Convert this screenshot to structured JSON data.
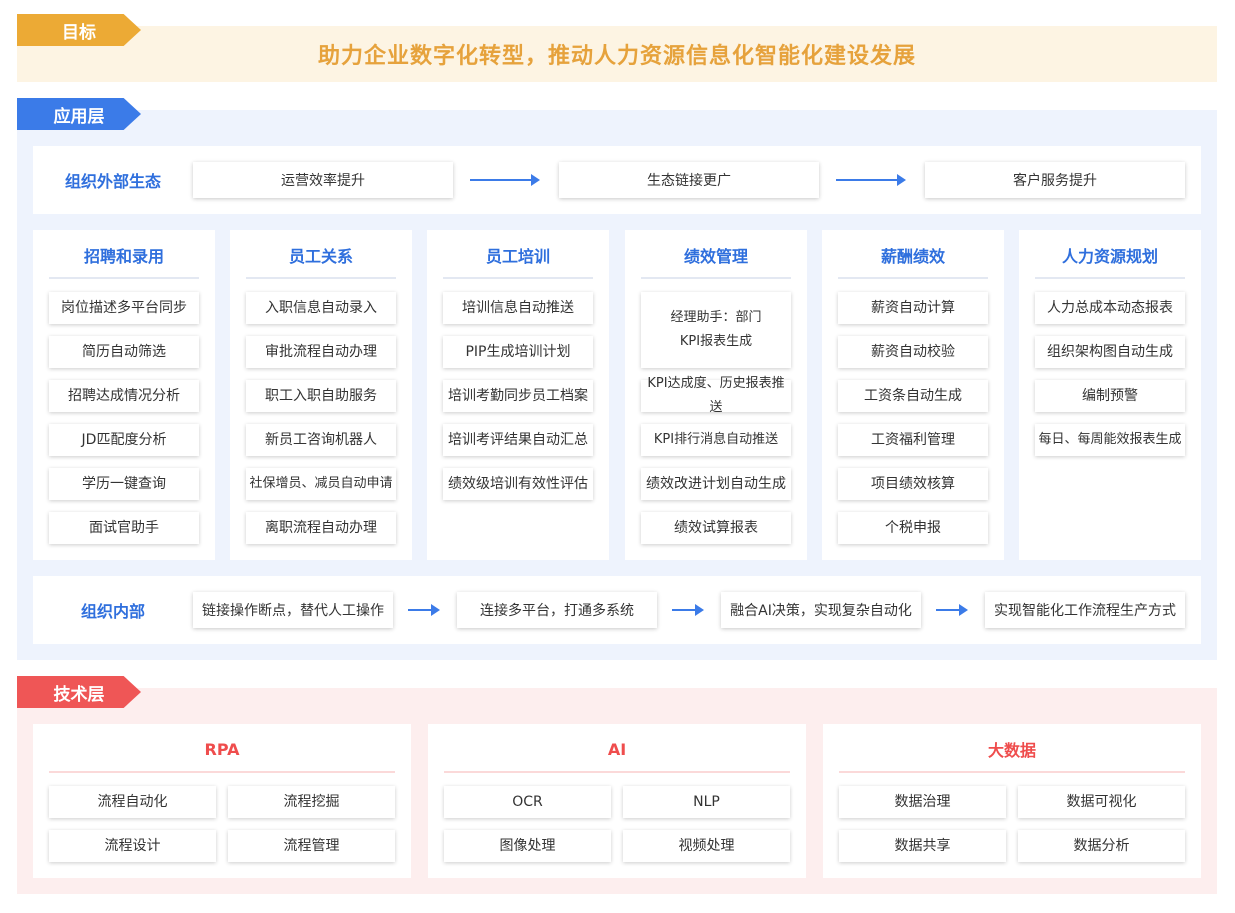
{
  "goal": {
    "tab": "目标",
    "text": "助力企业数字化转型，推动人力资源信息化智能化建设发展"
  },
  "app": {
    "tab": "应用层",
    "external": {
      "label": "组织外部生态",
      "steps": [
        "运营效率提升",
        "生态链接更广",
        "客户服务提升"
      ]
    },
    "columns": [
      {
        "title": "招聘和录用",
        "items": [
          "岗位描述多平台同步",
          "简历自动筛选",
          "招聘达成情况分析",
          "JD匹配度分析",
          "学历一键查询",
          "面试官助手"
        ]
      },
      {
        "title": "员工关系",
        "items": [
          "入职信息自动录入",
          "审批流程自动办理",
          "职工入职自助服务",
          "新员工咨询机器人",
          "社保增员、减员自动申请",
          "离职流程自动办理"
        ]
      },
      {
        "title": "员工培训",
        "items": [
          "培训信息自动推送",
          "PIP生成培训计划",
          "培训考勤同步员工档案",
          "培训考评结果自动汇总",
          "绩效级培训有效性评估"
        ]
      },
      {
        "title": "绩效管理",
        "items": [
          "经理助手：部门KPI报表生成",
          "KPI达成度、历史报表推送",
          "KPI排行消息自动推送",
          "绩效改进计划自动生成",
          "绩效试算报表"
        ]
      },
      {
        "title": "薪酬绩效",
        "items": [
          "薪资自动计算",
          "薪资自动校验",
          "工资条自动生成",
          "工资福利管理",
          "项目绩效核算",
          "个税申报"
        ]
      },
      {
        "title": "人力资源规划",
        "items": [
          "人力总成本动态报表",
          "组织架构图自动生成",
          "编制预警",
          "每日、每周能效报表生成"
        ]
      }
    ],
    "internal": {
      "label": "组织内部",
      "steps": [
        "链接操作断点，替代人工操作",
        "连接多平台，打通多系统",
        "融合AI决策，实现复杂自动化",
        "实现智能化工作流程生产方式"
      ]
    }
  },
  "tech": {
    "tab": "技术层",
    "groups": [
      {
        "title": "RPA",
        "items": [
          "流程自动化",
          "流程挖掘",
          "流程设计",
          "流程管理"
        ]
      },
      {
        "title": "AI",
        "items": [
          "OCR",
          "NLP",
          "图像处理",
          "视频处理"
        ]
      },
      {
        "title": "大数据",
        "items": [
          "数据治理",
          "数据可视化",
          "数据共享",
          "数据分析"
        ]
      }
    ]
  },
  "colors": {
    "goal": "#ecaa35",
    "app": "#3b7be8",
    "tech": "#ef5656"
  }
}
